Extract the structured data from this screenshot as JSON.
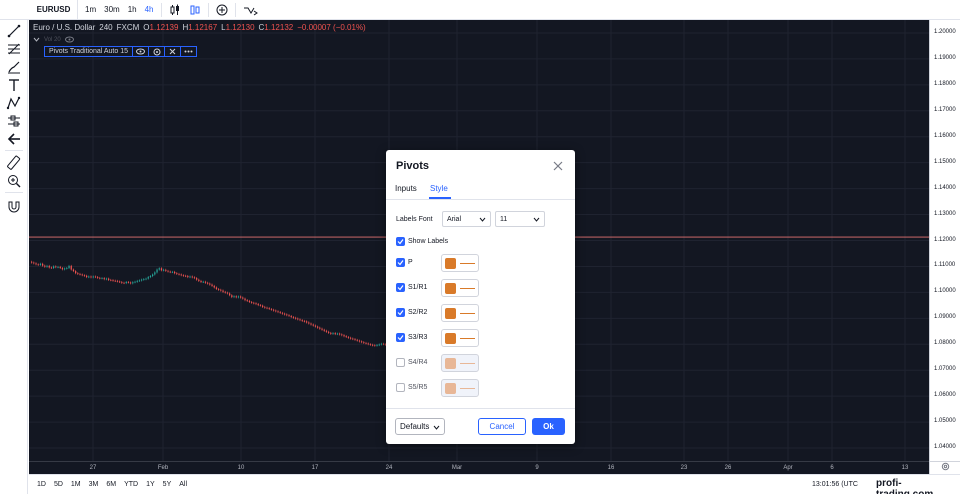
{
  "toolbar": {
    "symbol": "EURUSD",
    "timeframes": [
      {
        "label": "1m",
        "active": false
      },
      {
        "label": "30m",
        "active": false
      },
      {
        "label": "1h",
        "active": false
      },
      {
        "label": "4h",
        "active": true
      }
    ]
  },
  "left_tools": [
    "crosshair-icon",
    "trend-line-icon",
    "fib-icon",
    "brush-icon",
    "text-icon",
    "pattern-icon",
    "forecast-icon",
    "back-arrow-icon",
    "ruler-icon",
    "zoom-icon",
    "magnet-icon"
  ],
  "legend": {
    "title": "Euro / U.S. Dollar",
    "interval": "240",
    "exchange": "FXCM",
    "o_key": "O",
    "o": "1.12139",
    "h_key": "H",
    "h": "1.12167",
    "l_key": "L",
    "l": "1.12130",
    "c_key": "C",
    "c": "1.12132",
    "change": "−0.00007 (−0.01%)",
    "vol_label": "Vol 20"
  },
  "pivot_indicator": {
    "name": "Pivots Traditional Auto 15"
  },
  "price_axis": [
    "1.20000",
    "1.19000",
    "1.18000",
    "1.17000",
    "1.16000",
    "1.15000",
    "1.14000",
    "1.13000",
    "1.12000",
    "1.11000",
    "1.10000",
    "1.09000",
    "1.08000",
    "1.07000",
    "1.06000",
    "1.05000",
    "1.04000"
  ],
  "time_axis": [
    "27",
    "Feb",
    "10",
    "17",
    "24",
    "Mar",
    "9",
    "16",
    "23",
    "26",
    "Apr",
    "6",
    "13"
  ],
  "bottom": {
    "ranges": [
      "1D",
      "5D",
      "1M",
      "3M",
      "6M",
      "YTD",
      "1Y",
      "5Y",
      "All"
    ],
    "clock": "13:01:56 (UTC",
    "watermark": "profi-trading.com"
  },
  "dialog": {
    "title": "Pivots",
    "tabs": [
      {
        "label": "Inputs",
        "active": false
      },
      {
        "label": "Style",
        "active": true
      }
    ],
    "labels_font_label": "Labels Font",
    "font_value": "Arial",
    "size_value": "11",
    "show_labels": {
      "label": "Show Labels",
      "checked": true
    },
    "levels": [
      {
        "label": "P",
        "checked": true,
        "color": "#d97a29"
      },
      {
        "label": "S1/R1",
        "checked": true,
        "color": "#d97a29"
      },
      {
        "label": "S2/R2",
        "checked": true,
        "color": "#d97a29"
      },
      {
        "label": "S3/R3",
        "checked": true,
        "color": "#d97a29"
      },
      {
        "label": "S4/R4",
        "checked": false,
        "color": "#e8b797"
      },
      {
        "label": "S5/R5",
        "checked": false,
        "color": "#e8b797"
      }
    ],
    "defaults_label": "Defaults",
    "cancel_label": "Cancel",
    "ok_label": "Ok"
  },
  "colors": {
    "accent": "#2962ff",
    "chart_bg": "#131722",
    "up_candle": "#26a69a",
    "down_candle": "#ef5350",
    "pivot_line": "#e57373"
  },
  "price_series": {
    "axis_range": [
      1.035,
      1.205
    ],
    "current_price": 1.12132,
    "closes": [
      1.1115,
      1.1112,
      1.1108,
      1.1106,
      1.111,
      1.1103,
      1.1099,
      1.1102,
      1.1096,
      1.1094,
      1.11,
      1.1097,
      1.1098,
      1.1094,
      1.1089,
      1.1092,
      1.1094,
      1.1102,
      1.1088,
      1.1082,
      1.1074,
      1.1071,
      1.1069,
      1.1066,
      1.1064,
      1.1059,
      1.1061,
      1.1058,
      1.1061,
      1.1059,
      1.1056,
      1.1054,
      1.1055,
      1.1051,
      1.1053,
      1.1048,
      1.1047,
      1.1045,
      1.1044,
      1.1042,
      1.104,
      1.1037,
      1.1036,
      1.104,
      1.1038,
      1.1035,
      1.1039,
      1.1041,
      1.1044,
      1.1046,
      1.1049,
      1.1051,
      1.1053,
      1.1059,
      1.1063,
      1.1069,
      1.1077,
      1.1088,
      1.1093,
      1.1085,
      1.1087,
      1.1083,
      1.108,
      1.1078,
      1.1079,
      1.1074,
      1.1071,
      1.1069,
      1.1066,
      1.1064,
      1.1063,
      1.1059,
      1.1061,
      1.1058,
      1.1055,
      1.1049,
      1.1044,
      1.104,
      1.1041,
      1.1037,
      1.1034,
      1.103,
      1.1025,
      1.1019,
      1.1013,
      1.101,
      1.1007,
      1.1002,
      1.0999,
      1.0996,
      1.0989,
      1.0982,
      1.0985,
      1.0981,
      1.0984,
      1.098,
      1.0976,
      1.097,
      1.0967,
      1.0963,
      1.096,
      1.0958,
      1.0955,
      1.0951,
      1.0949,
      1.0944,
      1.0941,
      1.0939,
      1.0936,
      1.0933,
      1.093,
      1.0927,
      1.0924,
      1.0921,
      1.0918,
      1.0915,
      1.0912,
      1.0909,
      1.0905,
      1.0902,
      1.0899,
      1.0896,
      1.0893,
      1.089,
      1.0888,
      1.0884,
      1.088,
      1.0876,
      1.0872,
      1.0868,
      1.0864,
      1.086,
      1.0856,
      1.0852,
      1.0848,
      1.0844,
      1.084,
      1.0843,
      1.0839,
      1.0841,
      1.0838,
      1.0835,
      1.0831,
      1.0828,
      1.0825,
      1.0822,
      1.082,
      1.0817,
      1.0814,
      1.0811,
      1.0808,
      1.0805,
      1.0803,
      1.08,
      1.0798,
      1.0796,
      1.0795,
      1.0797,
      1.0799,
      1.0802,
      1.08,
      1.0798,
      1.0801,
      1.0805,
      1.0811,
      1.0818,
      1.0826,
      1.0838,
      1.0852
    ]
  }
}
